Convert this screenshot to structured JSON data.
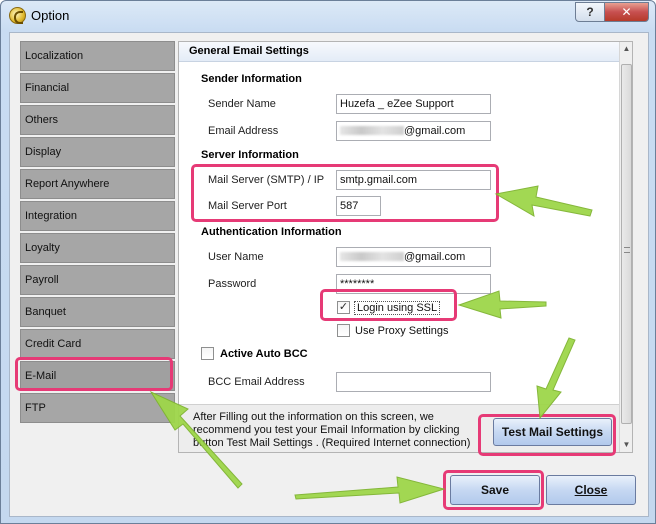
{
  "window": {
    "title": "Option",
    "help_label": "?",
    "close_label": "✕"
  },
  "sidebar": {
    "items": [
      {
        "label": "Localization"
      },
      {
        "label": "Financial"
      },
      {
        "label": "Others"
      },
      {
        "label": "Display"
      },
      {
        "label": "Report Anywhere"
      },
      {
        "label": "Integration"
      },
      {
        "label": "Loyalty"
      },
      {
        "label": "Payroll"
      },
      {
        "label": "Banquet"
      },
      {
        "label": "Credit Card"
      },
      {
        "label": "E-Mail"
      },
      {
        "label": "FTP"
      }
    ],
    "active": "E-Mail"
  },
  "email": {
    "section_title": "General Email Settings",
    "sender_group": "Sender Information",
    "sender_name_label": "Sender Name",
    "sender_name_value": "Huzefa _ eZee Support",
    "email_address_label": "Email Address",
    "email_address_suffix": "@gmail.com",
    "server_group": "Server Information",
    "smtp_label": "Mail Server (SMTP) / IP",
    "smtp_value": "smtp.gmail.com",
    "port_label": "Mail Server Port",
    "port_value": "587",
    "auth_group": "Authentication Information",
    "username_label": "User Name",
    "username_suffix": "@gmail.com",
    "password_label": "Password",
    "password_value": "********",
    "ssl_label": "Login using SSL",
    "ssl_checked": "✓",
    "proxy_label": "Use Proxy Settings",
    "auto_bcc_label": "Active Auto BCC",
    "bcc_label": "BCC Email Address",
    "bcc_value": "",
    "footer_note": "After Filling out the information on this screen, we recommend you test your Email Information by clicking button Test Mail Settings . (Required Internet connection)",
    "test_button": "Test Mail Settings"
  },
  "buttons": {
    "save": "Save",
    "close": "Close"
  },
  "colors": {
    "highlight": "#e63a76",
    "arrow": "#9ed64a",
    "nav": "#a6a6a6"
  }
}
